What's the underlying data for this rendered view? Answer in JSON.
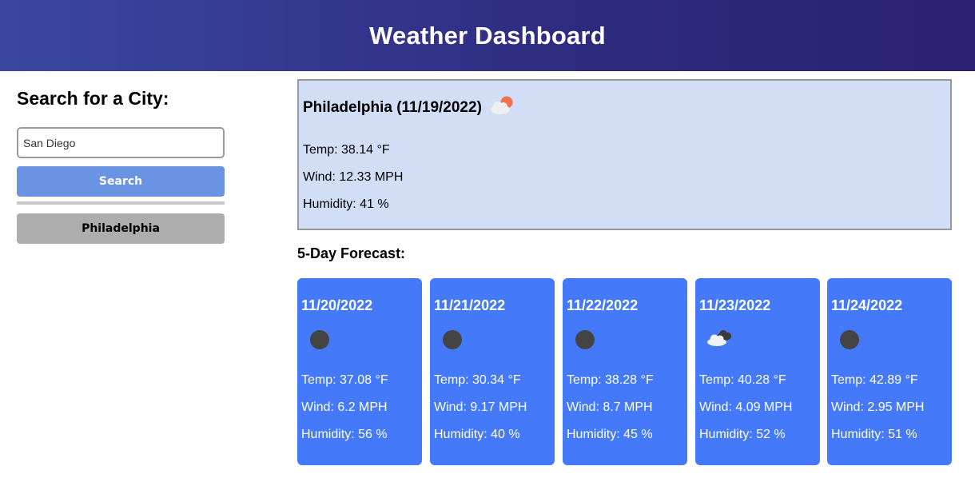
{
  "header": {
    "title": "Weather Dashboard"
  },
  "sidebar": {
    "heading": "Search for a City:",
    "search_value": "San Diego",
    "search_placeholder": "San Diego",
    "search_button": "Search",
    "history": [
      "Philadelphia"
    ]
  },
  "current": {
    "title": "Philadelphia (11/19/2022)",
    "icon": "partly-cloudy-icon",
    "temp": "Temp: 38.14 °F",
    "wind": "Wind: 12.33 MPH",
    "humidity": "Humidity: 41 %"
  },
  "forecast": {
    "heading": "5-Day Forecast:",
    "days": [
      {
        "date": "11/20/2022",
        "icon": "clear-night-icon",
        "temp": "Temp: 37.08 °F",
        "wind": "Wind: 6.2 MPH",
        "humidity": "Humidity: 56 %"
      },
      {
        "date": "11/21/2022",
        "icon": "clear-night-icon",
        "temp": "Temp: 30.34 °F",
        "wind": "Wind: 9.17 MPH",
        "humidity": "Humidity: 40 %"
      },
      {
        "date": "11/22/2022",
        "icon": "clear-night-icon",
        "temp": "Temp: 38.28 °F",
        "wind": "Wind: 8.7 MPH",
        "humidity": "Humidity: 45 %"
      },
      {
        "date": "11/23/2022",
        "icon": "broken-clouds-icon",
        "temp": "Temp: 40.28 °F",
        "wind": "Wind: 4.09 MPH",
        "humidity": "Humidity: 52 %"
      },
      {
        "date": "11/24/2022",
        "icon": "clear-night-icon",
        "temp": "Temp: 42.89 °F",
        "wind": "Wind: 2.95 MPH",
        "humidity": "Humidity: 51 %"
      }
    ]
  },
  "colors": {
    "header_start": "#3a47a0",
    "header_end": "#2b2172",
    "search_button": "#6a93e4",
    "history_button": "#adadad",
    "current_bg": "#d2ddf6",
    "card_bg": "#4479fa"
  }
}
